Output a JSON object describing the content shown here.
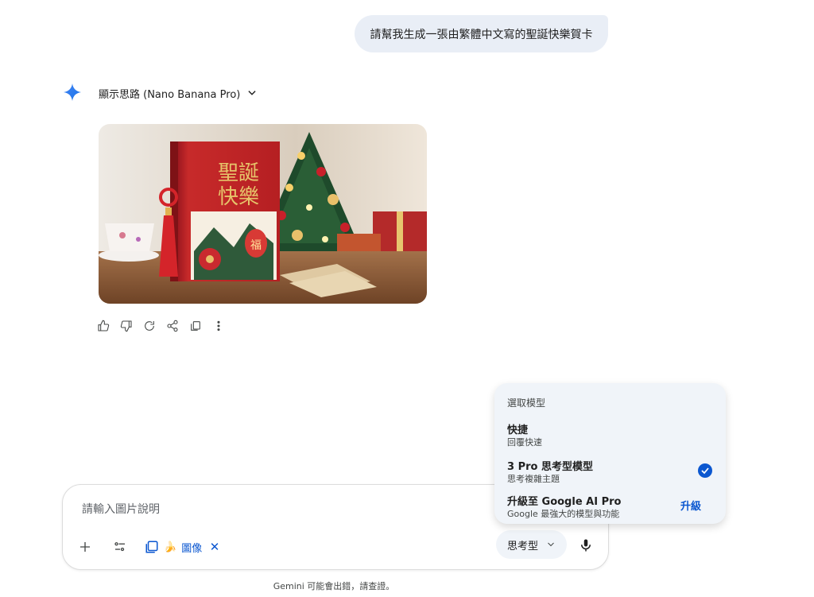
{
  "user_message": "請幫我生成一張由繁體中文寫的聖誕快樂賀卡",
  "response": {
    "thoughts_label": "顯示思路 (Nano Banana Pro)",
    "card_text_line1": "聖誕",
    "card_text_line2": "快樂",
    "lantern_char": "福",
    "actions": [
      "thumbs-up-icon",
      "thumbs-down-icon",
      "regenerate-icon",
      "share-icon",
      "copy-icon",
      "more-icon"
    ]
  },
  "composer": {
    "placeholder": "請輸入圖片說明",
    "chip_label": "圖像",
    "chip_emoji": "🍌",
    "chip_close": "✕",
    "mode_label": "思考型"
  },
  "model_menu": {
    "title": "選取模型",
    "items": [
      {
        "name": "快捷",
        "sub": "回覆快速"
      },
      {
        "name": "3 Pro 思考型模型",
        "sub": "思考複雜主題",
        "selected": true
      },
      {
        "name": "升級至 Google AI Pro",
        "sub": "Google 最強大的模型與功能",
        "action": "升級"
      }
    ]
  },
  "disclaimer": "Gemini 可能會出錯，請查證。",
  "colors": {
    "accent": "#0b57d0",
    "bubble": "#e9eef6",
    "menu_bg": "#f0f4f9"
  }
}
